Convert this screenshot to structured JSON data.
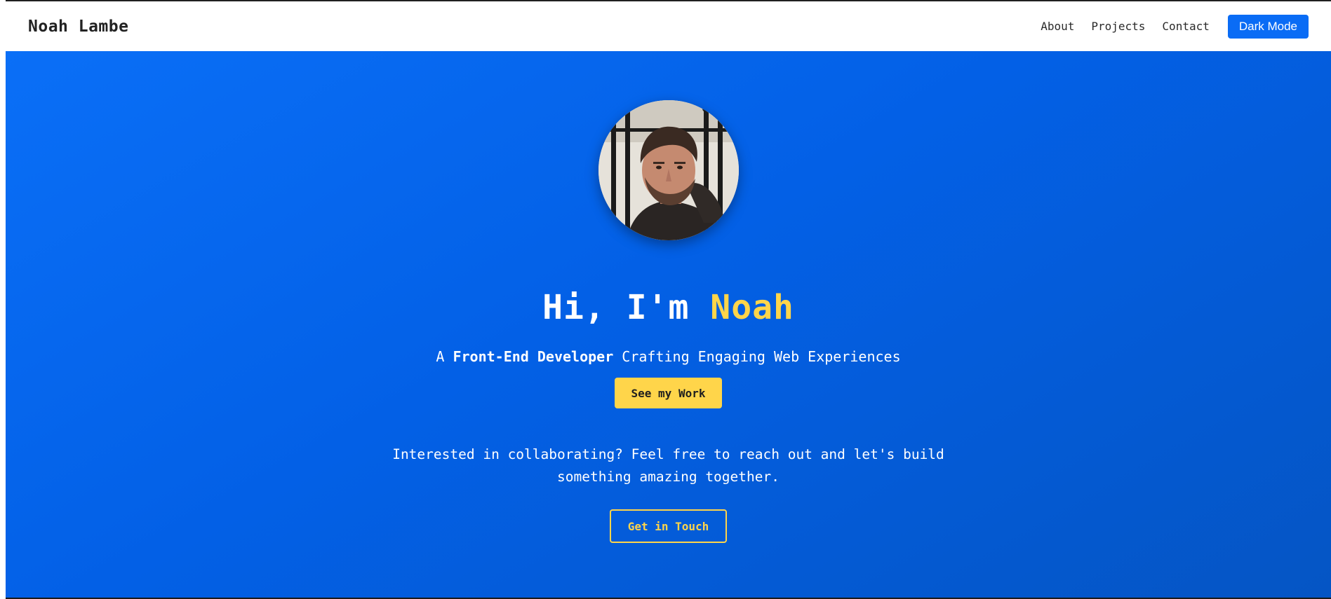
{
  "navbar": {
    "brand": "Noah Lambe",
    "links": [
      "About",
      "Projects",
      "Contact"
    ],
    "dark_mode_label": "Dark Mode"
  },
  "hero": {
    "title_prefix": "Hi, I'm ",
    "title_name": "Noah",
    "tagline_prefix": "A ",
    "tagline_role": "Front-End Developer",
    "tagline_suffix": " Crafting Engaging Web Experiences",
    "work_button": "See my Work",
    "collab_text": "Interested in collaborating? Feel free to reach out and let's build something amazing together.",
    "touch_button": "Get in Touch"
  },
  "colors": {
    "accent": "#ffd54a",
    "primary": "#0a6cf5",
    "hero_gradient_start": "#0a6ff7",
    "hero_gradient_end": "#0555c4"
  },
  "icons": {
    "avatar": "profile-photo"
  }
}
